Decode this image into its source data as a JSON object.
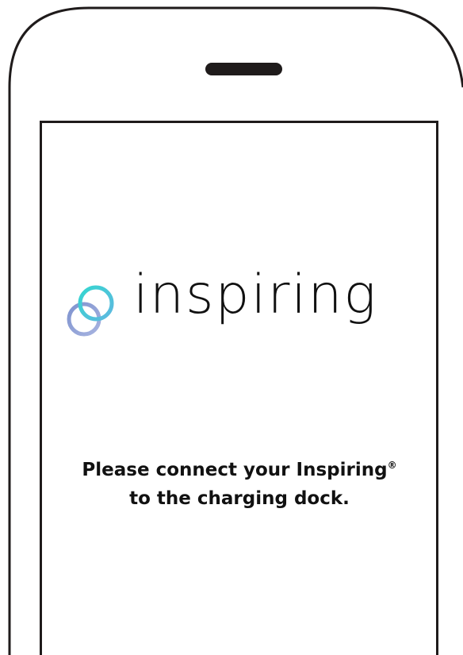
{
  "brand": {
    "name": "inspiring",
    "logo_ring_colors": [
      "#35d6d0",
      "#8fa3d6"
    ]
  },
  "message": {
    "line1": "Please connect your Inspiring",
    "registered_mark": "®",
    "line2": "to the charging dock."
  },
  "colors": {
    "frame": "#1f1b1b",
    "text": "#111111",
    "background": "#ffffff"
  }
}
